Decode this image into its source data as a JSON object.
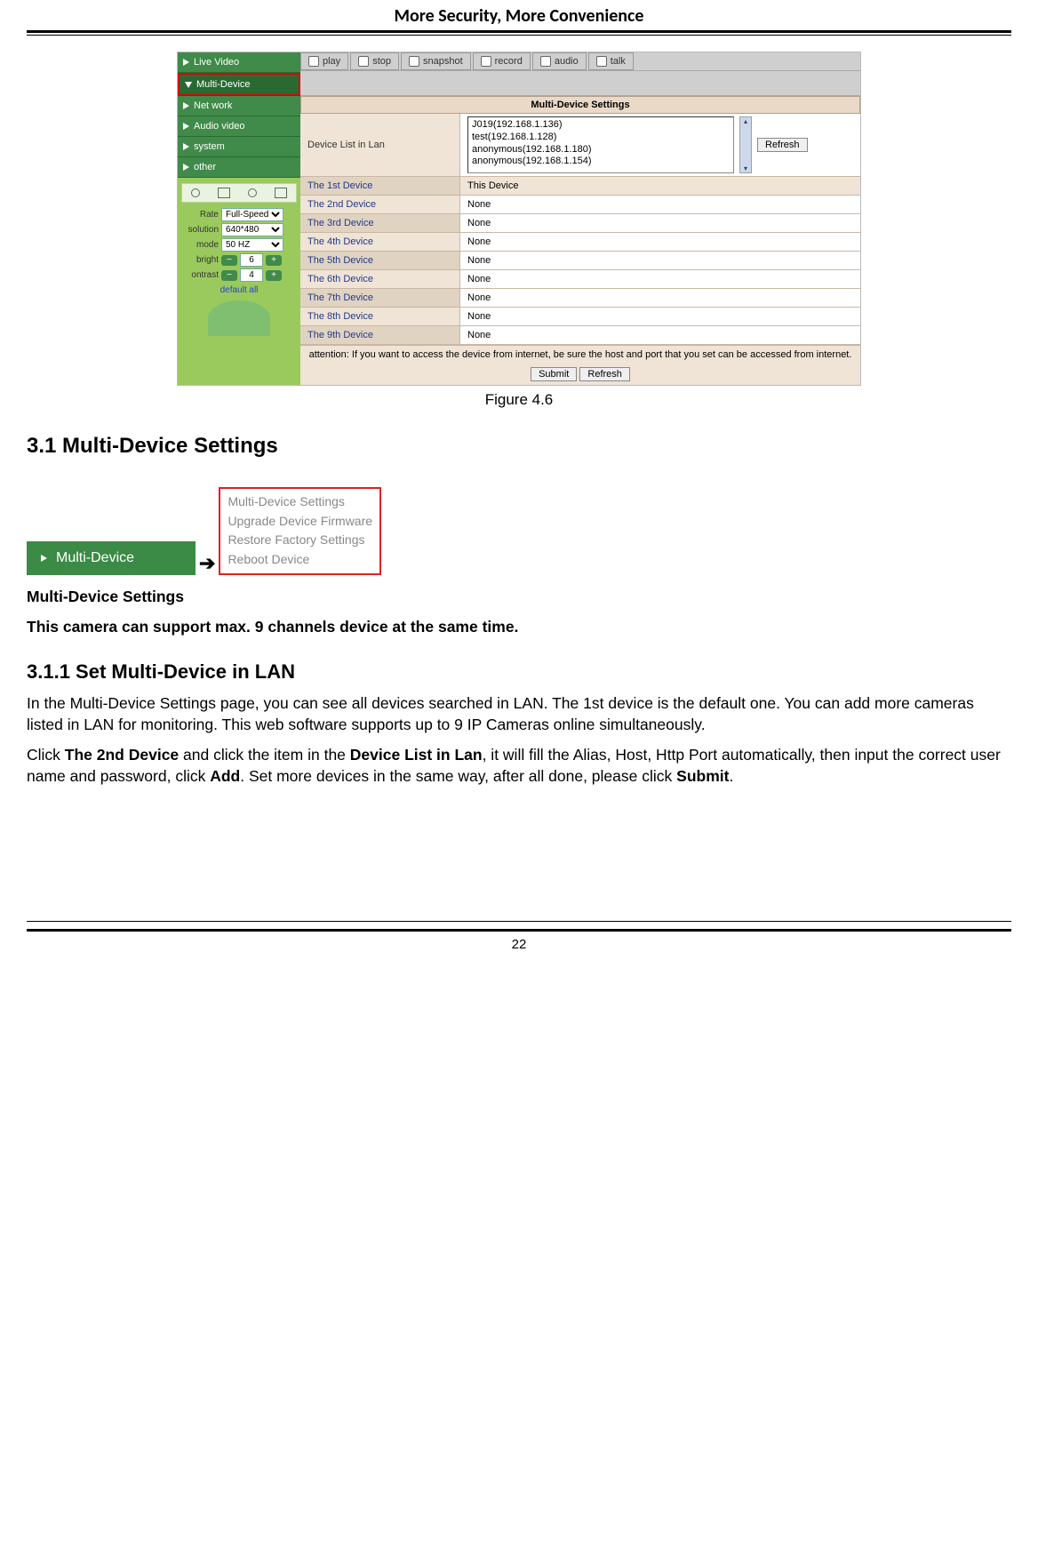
{
  "doc": {
    "header": "More Security, More Convenience",
    "page_number": "22"
  },
  "figure46": {
    "caption": "Figure 4.6",
    "nav": {
      "live_video": "Live Video",
      "multi_device": "Multi-Device",
      "net_work": "Net work",
      "audio_video": "Audio video",
      "system": "system",
      "other": "other"
    },
    "ctrl": {
      "rate_label": "Rate",
      "rate_value": "Full-Speed",
      "solution_label": "solution",
      "solution_value": "640*480",
      "mode_label": "mode",
      "mode_value": "50 HZ",
      "bright_label": "bright",
      "bright_value": "6",
      "contrast_label": "ontrast",
      "contrast_value": "4",
      "default_all": "default all"
    },
    "topbar": {
      "play": "play",
      "stop": "stop",
      "snapshot": "snapshot",
      "record": "record",
      "audio": "audio",
      "talk": "talk"
    },
    "mds": {
      "title": "Multi-Device Settings",
      "device_list_label": "Device List in Lan",
      "list": {
        "l1": "J019(192.168.1.136)",
        "l2": "test(192.168.1.128)",
        "l3": "anonymous(192.168.1.180)",
        "l4": "anonymous(192.168.1.154)"
      },
      "refresh_btn": "Refresh",
      "rows": {
        "r1l": "The 1st Device",
        "r1r": "This Device",
        "r2l": "The 2nd Device",
        "r2r": "None",
        "r3l": "The 3rd Device",
        "r3r": "None",
        "r4l": "The 4th Device",
        "r4r": "None",
        "r5l": "The 5th Device",
        "r5r": "None",
        "r6l": "The 6th Device",
        "r6r": "None",
        "r7l": "The 7th Device",
        "r7r": "None",
        "r8l": "The 8th Device",
        "r8r": "None",
        "r9l": "The 9th Device",
        "r9r": "None"
      },
      "attention": "attention: If you want to access the device from internet, be sure the host and port that you set can be accessed from internet.",
      "submit_btn": "Submit",
      "refresh2_btn": "Refresh"
    }
  },
  "section": {
    "h_3_1": "3.1 Multi-Device Settings",
    "inline_btn_label": "Multi-Device",
    "menu": {
      "m1": "Multi-Device Settings",
      "m2": "Upgrade Device Firmware",
      "m3": "Restore Factory Settings",
      "m4": "Reboot Device"
    },
    "sub_heading": "Multi-Device Settings",
    "support_line": "This camera can support max. 9 channels device at the same time.",
    "h_3_1_1": "3.1.1 Set Multi-Device in LAN",
    "p1": "In the Multi-Device Settings page, you can see all devices searched in LAN. The 1st device is the default one. You can add more cameras listed in LAN for monitoring. This web software supports up to 9 IP Cameras online simultaneously.",
    "p2a": "Click ",
    "p2b": "The 2nd Device",
    "p2c": " and click the item in the ",
    "p2d": "Device List in Lan",
    "p2e": ", it will fill the Alias, Host, Http Port automatically, then input the correct user name and password, click ",
    "p2f": "Add",
    "p2g": ". Set more devices in the same way, after all done, please click ",
    "p2h": "Submit",
    "p2i": "."
  }
}
